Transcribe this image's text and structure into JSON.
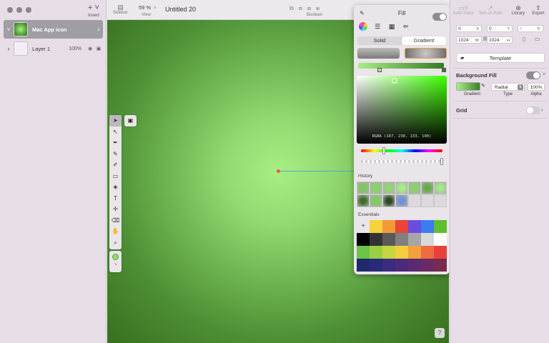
{
  "sidebar": {
    "insert_label": "Insert",
    "layers": [
      {
        "name": "Mac App icon"
      },
      {
        "name": "Layer 1",
        "opacity": "100%"
      }
    ]
  },
  "toolbar": {
    "sidebar_label": "Sidebar",
    "view_label": "View",
    "zoom_value": "59 %",
    "document_title": "Untitled 20",
    "boolean_label": "Boolean",
    "auto_trace_label": "Auto Trace",
    "text_on_path_label": "Text on Path",
    "library_label": "Library",
    "export_label": "Export"
  },
  "fill_popover": {
    "title": "Fill",
    "enabled": true,
    "tabs": [
      "Solid",
      "Gradient"
    ],
    "active_tab": "Gradient",
    "rgba_readout": "RGBA (167, 238, 133, 100)",
    "history_label": "History",
    "essentials_label": "Essentials",
    "history_colors": [
      "#7cc95c",
      "#88d468",
      "#92d672",
      "#a7ee85",
      "#8ad36b",
      "#66aa48",
      "#a3e884",
      "#3e6e2c",
      "#7fcb5f",
      "#2b4a22",
      "#6f93d8"
    ],
    "essentials_colors": [
      "#f6d33a",
      "#f29b35",
      "#e8443b",
      "#6a4de0",
      "#3d7bf2",
      "#5fbf2f",
      "#000000",
      "#333333",
      "#595959",
      "#808080",
      "#a6a6a6",
      "#d9d9d9",
      "#ffffff",
      "#6cc34a",
      "#98cf43",
      "#c6d540",
      "#f5cd3c",
      "#f2a13e",
      "#ee6c3d",
      "#e6423a",
      "#1f2a6b",
      "#2a2a7a",
      "#3c2c7f",
      "#4b2a7c",
      "#5a2a72",
      "#6a2a63",
      "#7a2a4f"
    ]
  },
  "inspector": {
    "x_value": "0",
    "x_unit": "X",
    "y_value": "0",
    "y_unit": "Y",
    "rotation_value": "0",
    "width_value": "1024",
    "width_unit": "W",
    "height_value": "1024",
    "height_unit": "H",
    "template_label": "Template",
    "background_fill_label": "Background Fill",
    "fill_kind_label": "Gradient",
    "gradient_type_value": "Radial",
    "type_label": "Type",
    "alpha_value": "100%",
    "alpha_label": "Alpha",
    "grid_label": "Grid"
  },
  "colors": {
    "accent_green": "#a7ee85",
    "gradient_edge": "#37701f",
    "gradient_line": "#4aa7d8",
    "gradient_origin": "#f05a3a"
  }
}
